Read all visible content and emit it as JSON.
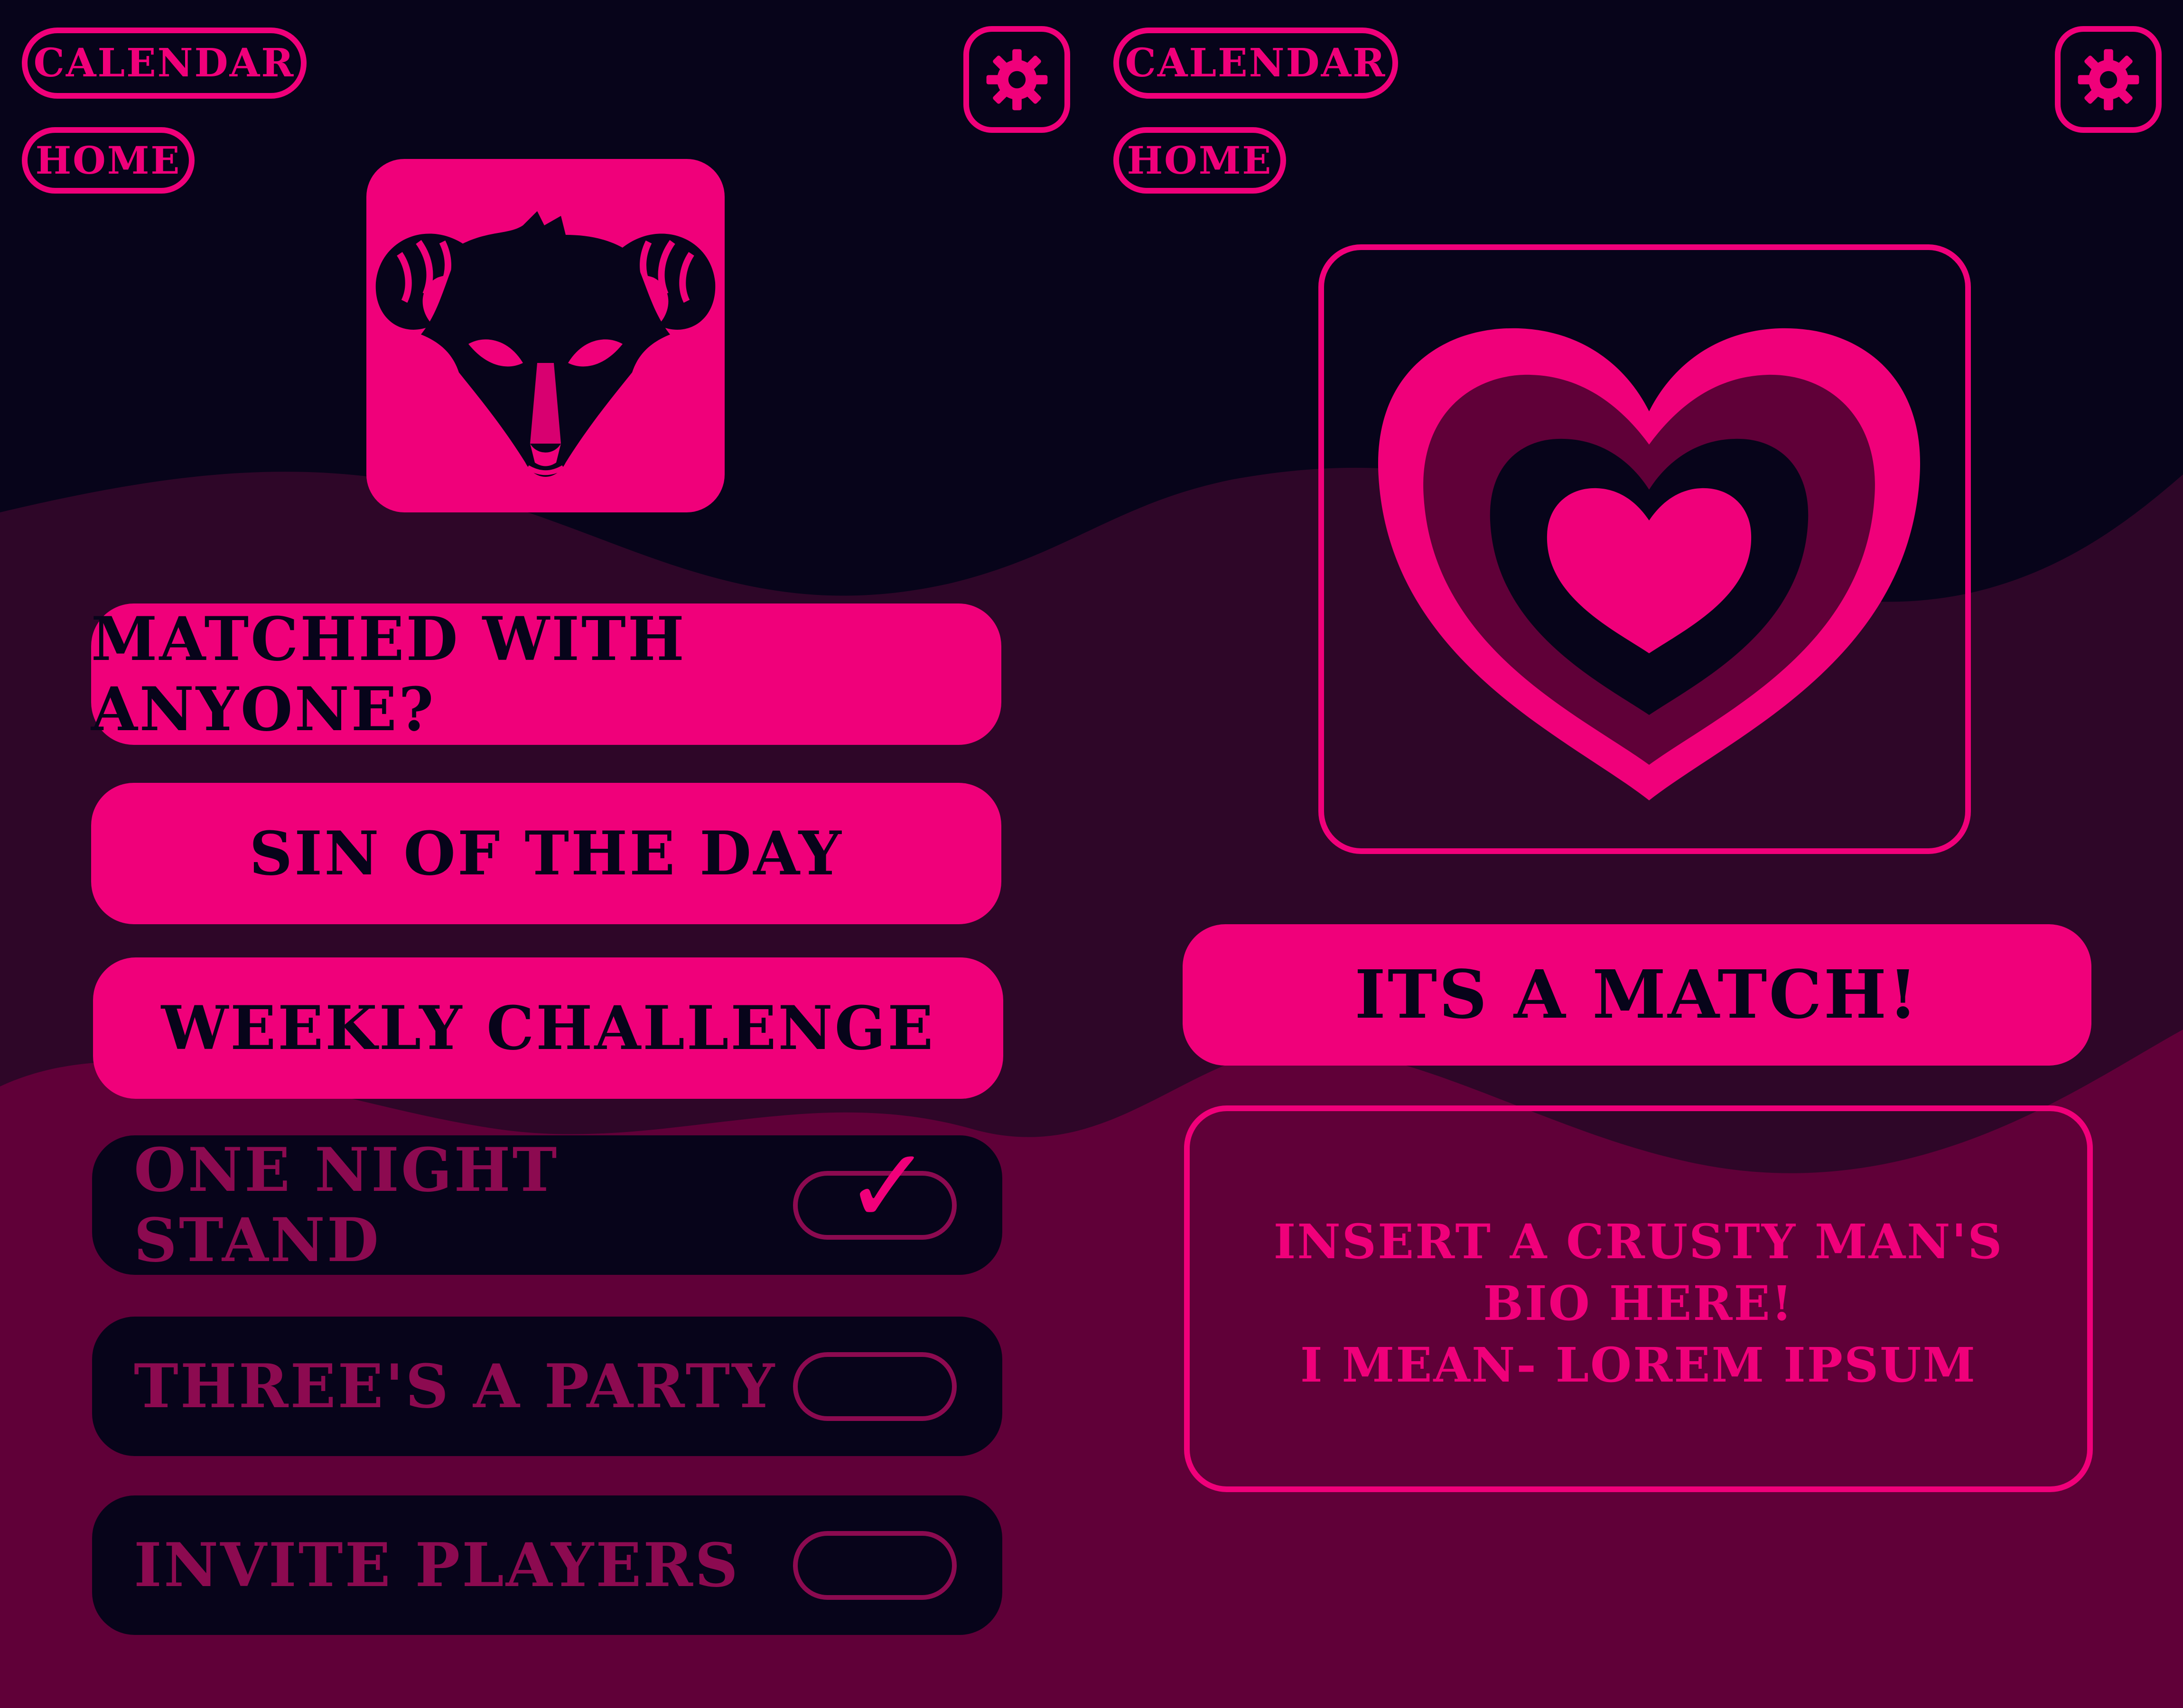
{
  "colors": {
    "accent": "#f0007a",
    "dark_navy": "#07041a",
    "wave_mid": "#2e0628",
    "wave_low": "#600038",
    "muted_text": "#8c0a50"
  },
  "screens": [
    {
      "nav": {
        "calendar": "CALENDAR",
        "home": "HOME"
      },
      "settings_icon": "gear-icon",
      "avatar_icon": "ram-skull-icon",
      "menu": {
        "matched": "MATCHED WITH ANYONE?",
        "sin": "SIN OF THE DAY",
        "weekly": "WEEKLY CHALLENGE"
      },
      "options": [
        {
          "label": "ONE NIGHT STAND",
          "checked": true
        },
        {
          "label": "THREE'S A PARTY",
          "checked": false
        },
        {
          "label": "INVITE PLAYERS",
          "checked": false
        }
      ],
      "check_glyph": "✓"
    },
    {
      "nav": {
        "calendar": "CALENDAR",
        "home": "HOME"
      },
      "settings_icon": "gear-icon",
      "heart_icon": "concentric-heart-icon",
      "match_banner": "ITS A MATCH!",
      "bio": [
        "INSERT A CRUSTY MAN'S",
        "BIO HERE!",
        "I MEAN- LOREM IPSUM"
      ]
    }
  ]
}
